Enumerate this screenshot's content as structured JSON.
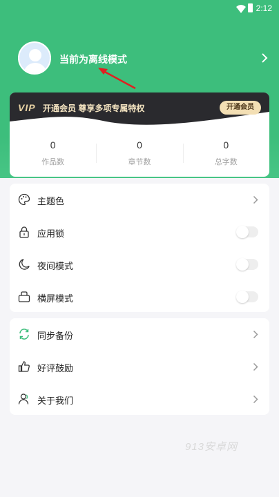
{
  "status_bar": {
    "time": "2:12"
  },
  "profile": {
    "name": "当前为离线模式"
  },
  "vip": {
    "logo": "VIP",
    "text": "开通会员 尊享多项专属特权",
    "button": "开通会员"
  },
  "stats": [
    {
      "value": "0",
      "label": "作品数"
    },
    {
      "value": "0",
      "label": "章节数"
    },
    {
      "value": "0",
      "label": "总字数"
    }
  ],
  "settings": [
    {
      "label": "主题色",
      "icon": "palette-icon",
      "control": "arrow"
    },
    {
      "label": "应用锁",
      "icon": "lock-icon",
      "control": "toggle",
      "on": false
    },
    {
      "label": "夜间模式",
      "icon": "moon-icon",
      "control": "toggle",
      "on": false
    },
    {
      "label": "横屏模式",
      "icon": "landscape-icon",
      "control": "toggle",
      "on": false
    }
  ],
  "more": [
    {
      "label": "同步备份",
      "icon": "sync-icon"
    },
    {
      "label": "好评鼓励",
      "icon": "thumbs-up-icon"
    },
    {
      "label": "关于我们",
      "icon": "user-icon"
    }
  ],
  "watermark": "913安卓网",
  "colors": {
    "accent": "#3dbe7c",
    "vip_band": "#2a2a2e",
    "vip_gold": "#f3dfb4",
    "annotation": "#e02020"
  }
}
